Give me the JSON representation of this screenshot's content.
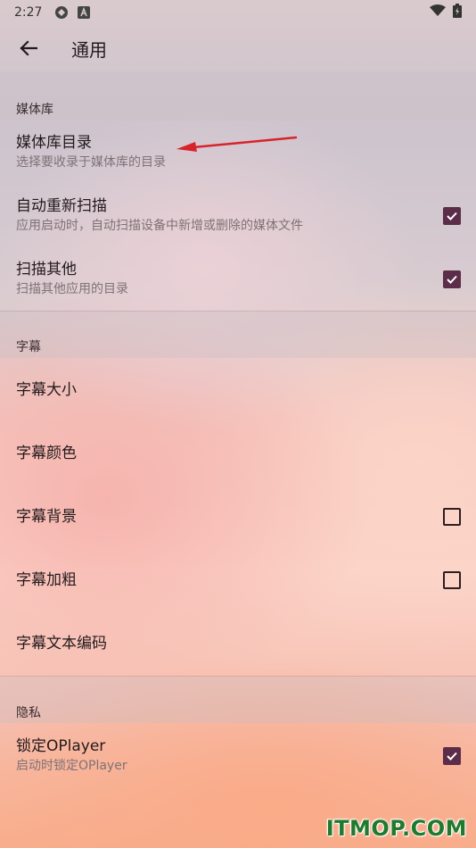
{
  "status_bar": {
    "time": "2:27",
    "icons": [
      "sync-icon",
      "a-badge-icon",
      "wifi-icon",
      "battery-charging-icon"
    ]
  },
  "app_bar": {
    "title": "通用",
    "back_icon": "arrow-left-icon"
  },
  "sections": [
    {
      "header": "媒体库",
      "items": [
        {
          "title": "媒体库目录",
          "summary": "选择要收录于媒体库的目录",
          "checkbox": null
        },
        {
          "title": "自动重新扫描",
          "summary": "应用启动时，自动扫描设备中新增或删除的媒体文件",
          "checkbox": true
        },
        {
          "title": "扫描其他",
          "summary": "扫描其他应用的目录",
          "checkbox": true
        }
      ]
    },
    {
      "header": "字幕",
      "items": [
        {
          "title": "字幕大小",
          "summary": "",
          "checkbox": null
        },
        {
          "title": "字幕颜色",
          "summary": "",
          "checkbox": null
        },
        {
          "title": "字幕背景",
          "summary": "",
          "checkbox": false
        },
        {
          "title": "字幕加粗",
          "summary": "",
          "checkbox": false
        },
        {
          "title": "字幕文本编码",
          "summary": "",
          "checkbox": null
        }
      ]
    },
    {
      "header": "隐私",
      "items": [
        {
          "title": "锁定OPlayer",
          "summary": "启动时锁定OPlayer",
          "checkbox": true
        }
      ]
    }
  ],
  "colors": {
    "checkbox_checked": "#5b2d49",
    "annotation_arrow": "#d8232a",
    "watermark": "#1f7a2e"
  },
  "watermark": "ITMOP.COM"
}
